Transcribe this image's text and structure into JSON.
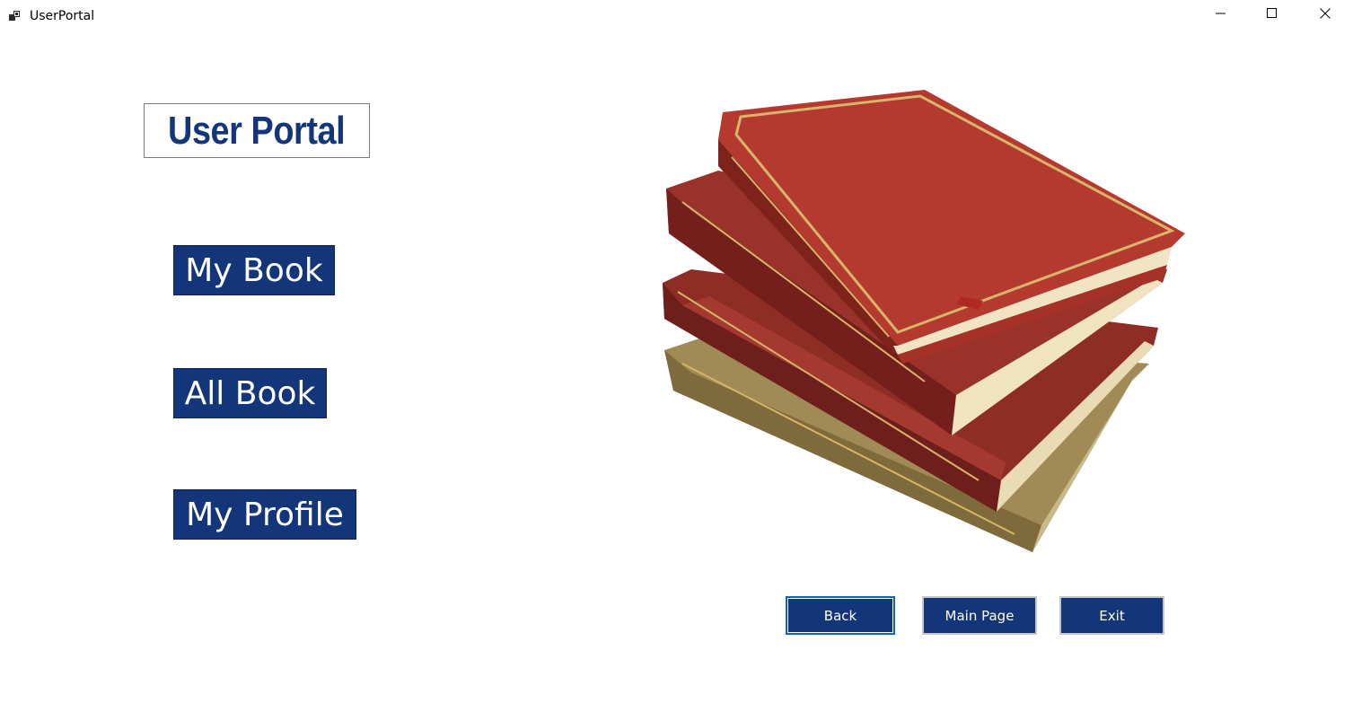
{
  "window": {
    "title": "UserPortal",
    "icons": {
      "app": "app-windows-icon",
      "minimize": "minimize-icon",
      "maximize": "maximize-icon",
      "close": "close-icon"
    }
  },
  "header": {
    "title": "User Portal"
  },
  "nav": {
    "my_book": "My Book",
    "all_book": "All Book",
    "my_profile": "My Profile"
  },
  "actions": {
    "back": "Back",
    "main_page": "Main Page",
    "exit": "Exit"
  },
  "colors": {
    "accent": "#133579",
    "background": "#ffffff",
    "focus_border": "#0a64c8"
  }
}
